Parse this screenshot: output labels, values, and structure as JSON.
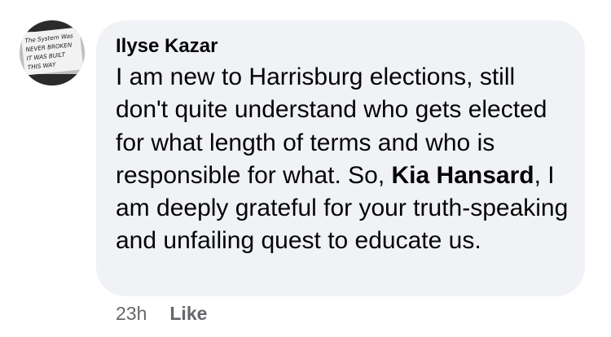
{
  "comment": {
    "author": "Ilyse Kazar",
    "text_before": "I am new to Harrisburg elections, still don't quite understand who gets elected for what length of terms and who is responsible for what. So, ",
    "mention": "Kia Hansard",
    "text_after": ", I am deeply grateful for your truth-speaking and unfailing quest to educate us.",
    "timestamp": "23h",
    "like_label": "Like"
  },
  "avatar": {
    "icon": "avatar-handwritten-sign",
    "lines": [
      "The System Was",
      "NEVER BROKEN",
      "IT WAS BUILT",
      "THIS WAY"
    ]
  },
  "colors": {
    "bubble_bg": "#f0f2f5",
    "text": "#050505",
    "meta_text": "#65676b"
  }
}
